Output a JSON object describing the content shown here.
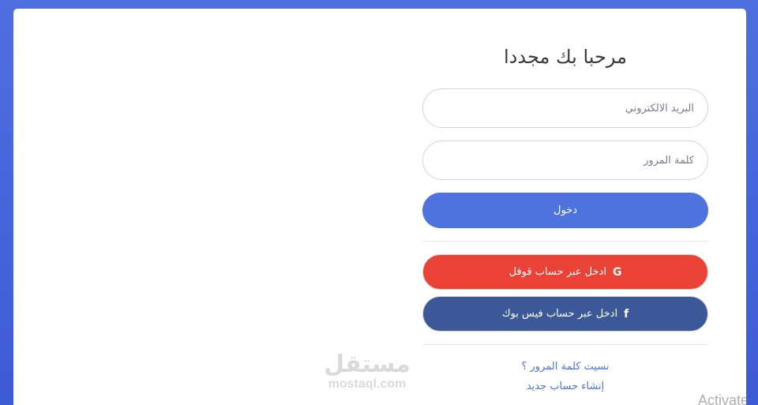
{
  "login_form": {
    "title": "مرحبا بك مجددا",
    "email_placeholder": "البريد الالكتروني",
    "password_placeholder": "كلمة المرور",
    "login_button": "دخول",
    "google_button": "ادخل عبر حساب قوقل",
    "facebook_button": "ادخل عبر حساب فيس بوك",
    "forgot_password_link": "نسيت كلمة المرور ؟",
    "register_link": "إنشاء حساب جديد"
  },
  "icons": {
    "google": "G",
    "facebook": "f"
  },
  "watermark": {
    "arabic": "مستقل",
    "latin": "mostaql.com"
  },
  "os_overlay": {
    "activate_text": "Activate"
  },
  "colors": {
    "background": "#4e6fe0",
    "primary": "#4e73df",
    "google": "#ea4335",
    "facebook": "#3b5998"
  }
}
